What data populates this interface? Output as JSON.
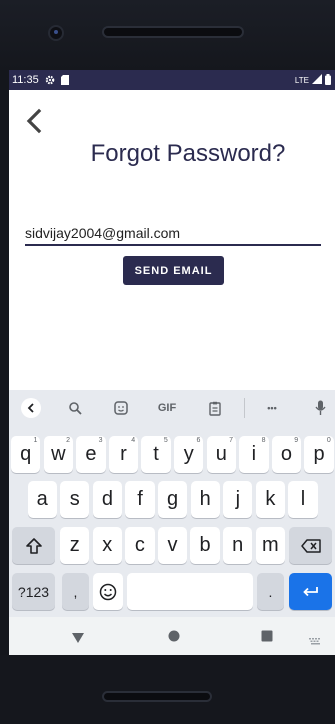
{
  "status": {
    "time": "11:35",
    "network": "LTE"
  },
  "page": {
    "title": "Forgot Password?"
  },
  "form": {
    "email_value": "sidvijay2004@gmail.com",
    "send_label": "SEND EMAIL"
  },
  "keyboard": {
    "toolbar": {
      "gif_label": "GIF",
      "more_label": "•••"
    },
    "row1": [
      {
        "k": "q",
        "h": "1"
      },
      {
        "k": "w",
        "h": "2"
      },
      {
        "k": "e",
        "h": "3"
      },
      {
        "k": "r",
        "h": "4"
      },
      {
        "k": "t",
        "h": "5"
      },
      {
        "k": "y",
        "h": "6"
      },
      {
        "k": "u",
        "h": "7"
      },
      {
        "k": "i",
        "h": "8"
      },
      {
        "k": "o",
        "h": "9"
      },
      {
        "k": "p",
        "h": "0"
      }
    ],
    "row2": [
      "a",
      "s",
      "d",
      "f",
      "g",
      "h",
      "j",
      "k",
      "l"
    ],
    "row3": [
      "z",
      "x",
      "c",
      "v",
      "b",
      "n",
      "m"
    ],
    "symbols_label": "?123",
    "comma_label": ",",
    "period_label": "."
  },
  "colors": {
    "primary": "#2b2b4f",
    "enter": "#1a73e8",
    "keyboard_bg": "#e7eaef"
  },
  "icons": [
    "back-chevron-icon",
    "settings-gear-icon",
    "sim-card-icon",
    "signal-icon",
    "battery-icon",
    "search-icon",
    "sticker-icon",
    "clipboard-icon",
    "mic-icon",
    "shift-icon",
    "backspace-icon",
    "emoji-icon",
    "enter-icon",
    "nav-back-icon",
    "nav-home-icon",
    "nav-recents-icon",
    "keyboard-switch-icon"
  ]
}
